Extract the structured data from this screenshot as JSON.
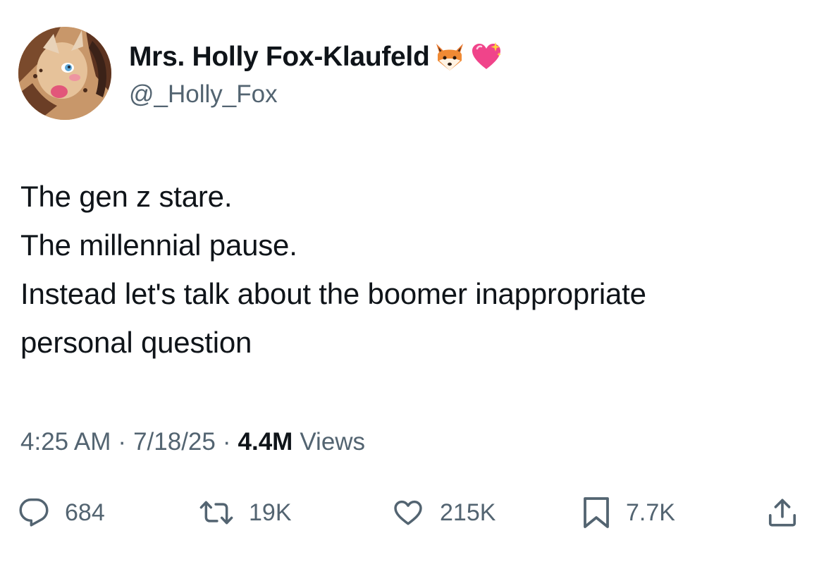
{
  "author": {
    "display_name": "Mrs. Holly Fox-Klaufeld",
    "handle": "@_Holly_Fox",
    "name_emojis": [
      "fox-face-icon",
      "sparkling-heart-icon"
    ]
  },
  "tweet": {
    "lines": [
      "The gen z stare.",
      "The millennial pause.",
      "Instead let's talk about the boomer inappropriate",
      "personal question"
    ]
  },
  "meta": {
    "time": "4:25 AM",
    "separator": "·",
    "date": "7/18/25",
    "views_count": "4.4M",
    "views_label": "Views"
  },
  "actions": {
    "replies": "684",
    "reposts": "19K",
    "likes": "215K",
    "bookmarks": "7.7K"
  },
  "colors": {
    "text_primary": "#0f1419",
    "text_secondary": "#536471",
    "background": "#ffffff"
  }
}
